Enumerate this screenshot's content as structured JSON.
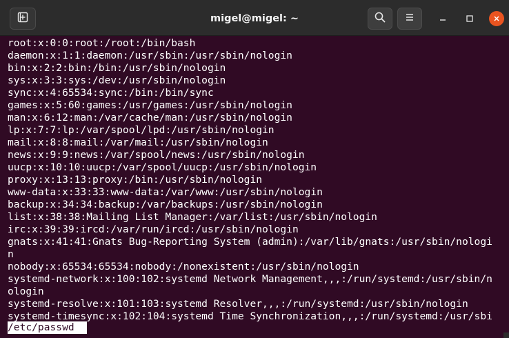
{
  "window": {
    "title": "migel@migel: ~"
  },
  "colors": {
    "terminal_bg": "#300a24",
    "titlebar_bg": "#2c2c2c",
    "text": "#ffffff",
    "close_button": "#e95420"
  },
  "icons": {
    "new_tab": "new-tab-icon",
    "search": "search-icon",
    "menu": "hamburger-menu-icon",
    "minimize": "minimize-icon",
    "maximize": "maximize-icon",
    "close": "close-icon"
  },
  "terminal": {
    "lines": [
      "root:x:0:0:root:/root:/bin/bash",
      "daemon:x:1:1:daemon:/usr/sbin:/usr/sbin/nologin",
      "bin:x:2:2:bin:/bin:/usr/sbin/nologin",
      "sys:x:3:3:sys:/dev:/usr/sbin/nologin",
      "sync:x:4:65534:sync:/bin:/bin/sync",
      "games:x:5:60:games:/usr/games:/usr/sbin/nologin",
      "man:x:6:12:man:/var/cache/man:/usr/sbin/nologin",
      "lp:x:7:7:lp:/var/spool/lpd:/usr/sbin/nologin",
      "mail:x:8:8:mail:/var/mail:/usr/sbin/nologin",
      "news:x:9:9:news:/var/spool/news:/usr/sbin/nologin",
      "uucp:x:10:10:uucp:/var/spool/uucp:/usr/sbin/nologin",
      "proxy:x:13:13:proxy:/bin:/usr/sbin/nologin",
      "www-data:x:33:33:www-data:/var/www:/usr/sbin/nologin",
      "backup:x:34:34:backup:/var/backups:/usr/sbin/nologin",
      "list:x:38:38:Mailing List Manager:/var/list:/usr/sbin/nologin",
      "irc:x:39:39:ircd:/var/run/ircd:/usr/sbin/nologin",
      "gnats:x:41:41:Gnats Bug-Reporting System (admin):/var/lib/gnats:/usr/sbin/nologi",
      "n",
      "nobody:x:65534:65534:nobody:/nonexistent:/usr/sbin/nologin",
      "systemd-network:x:100:102:systemd Network Management,,,:/run/systemd:/usr/sbin/n",
      "ologin",
      "systemd-resolve:x:101:103:systemd Resolver,,,:/run/systemd:/usr/sbin/nologin",
      "systemd-timesync:x:102:104:systemd Time Synchronization,,,:/run/systemd:/usr/sbi"
    ],
    "status_line": "/etc/passwd"
  }
}
